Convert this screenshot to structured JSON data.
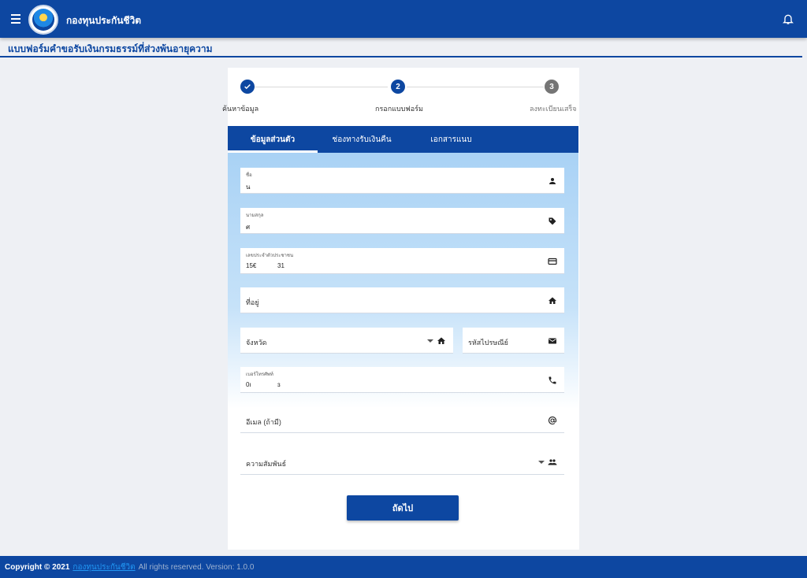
{
  "header": {
    "app_title": "กองทุนประกันชีวิต"
  },
  "page": {
    "title": "แบบฟอร์มคำขอรับเงินกรมธรรม์ที่ส่วงพ้นอายุความ"
  },
  "stepper": {
    "steps": [
      {
        "label": "ค้นหาข้อมูล",
        "number": "",
        "status": "done"
      },
      {
        "label": "กรอกแบบฟอร์ม",
        "number": "2",
        "status": "active"
      },
      {
        "label": "ลงทะเบียนเสร็จ",
        "number": "3",
        "status": "pending"
      }
    ]
  },
  "tabs": [
    {
      "label": "ข้อมูลส่วนตัว",
      "active": true
    },
    {
      "label": "ช่องทางรับเงินคืน",
      "active": false
    },
    {
      "label": "เอกสารแนบ",
      "active": false
    }
  ],
  "form": {
    "first_name": {
      "label": "ชื่อ",
      "value": "น",
      "icon": "person-icon"
    },
    "last_name": {
      "label": "นามสกุล",
      "value": "ศ",
      "icon": "tag-icon"
    },
    "id_card": {
      "label": "เลขประจำตัวประชาชน",
      "value": "15€            31",
      "icon": "credit-card-icon"
    },
    "address": {
      "placeholder": "ที่อยู่",
      "icon": "home-icon"
    },
    "province": {
      "placeholder": "จังหวัด",
      "icon": "home-icon"
    },
    "postcode": {
      "placeholder": "รหัสไปรษณีย์",
      "icon": "mail-icon"
    },
    "phone": {
      "label": "เบอร์โทรศัพท์",
      "value": "0ı               ɜ",
      "icon": "phone-icon"
    },
    "email": {
      "placeholder": "อีเมล (ถ้ามี)",
      "icon": "at-icon"
    },
    "relationship": {
      "placeholder": "ความสัมพันธ์",
      "icon": "people-icon"
    }
  },
  "actions": {
    "next_label": "ถัดไป"
  },
  "footer": {
    "copyright": "Copyright © 2021",
    "org_link": "กองทุนประกันชีวิต",
    "rights": "All rights reserved. Version: 1.0.0"
  },
  "colors": {
    "primary": "#0d47a1",
    "step_pending": "#757575",
    "link": "#2196f3"
  }
}
